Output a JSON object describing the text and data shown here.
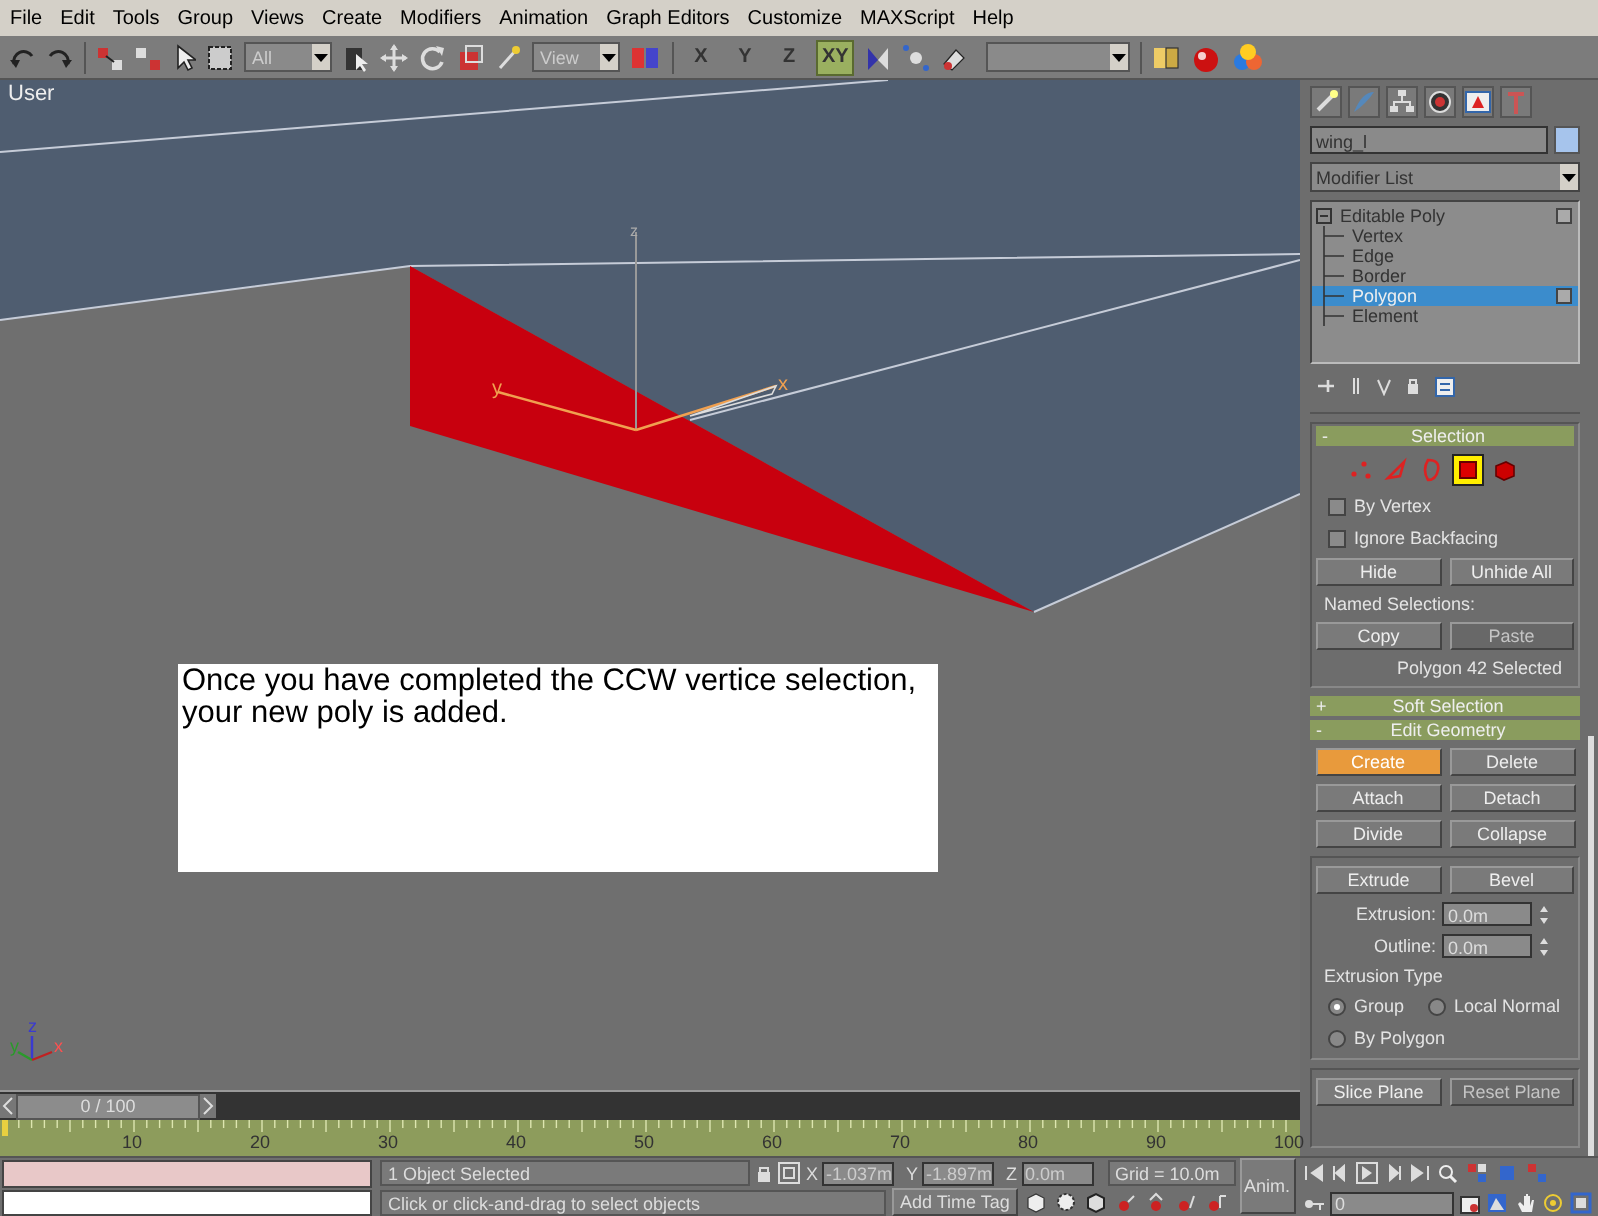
{
  "menu": [
    "File",
    "Edit",
    "Tools",
    "Group",
    "Views",
    "Create",
    "Modifiers",
    "Animation",
    "Graph Editors",
    "Customize",
    "MAXScript",
    "Help"
  ],
  "toolbar": {
    "selection_filter": "All",
    "coordinate_system": "View",
    "axis_buttons": [
      {
        "label": "X",
        "selected": false
      },
      {
        "label": "Y",
        "selected": false
      },
      {
        "label": "Z",
        "selected": false
      },
      {
        "label": "XY",
        "selected": true
      }
    ]
  },
  "viewport": {
    "label": "User",
    "gizmo": {
      "z": "z",
      "y": "y",
      "x": "x"
    },
    "tripod": {
      "z": "z",
      "y": "y",
      "x": "x"
    },
    "note": "Once you have completed the CCW vertice selection, your new poly is added."
  },
  "command_panel": {
    "object_name": "wing_l",
    "modifier_list": "Modifier List",
    "stack": [
      {
        "label": "Editable Poly",
        "selected": false,
        "expanded": true,
        "children": [
          {
            "label": "Vertex",
            "selected": false
          },
          {
            "label": "Edge",
            "selected": false
          },
          {
            "label": "Border",
            "selected": false
          },
          {
            "label": "Polygon",
            "selected": true
          },
          {
            "label": "Element",
            "selected": false
          }
        ]
      }
    ],
    "selection": {
      "toggle": "-",
      "title": "Selection",
      "subobject_levels": [
        {
          "kind": "vertex",
          "selected": false
        },
        {
          "kind": "edge",
          "selected": false
        },
        {
          "kind": "border",
          "selected": false
        },
        {
          "kind": "polygon",
          "selected": true
        },
        {
          "kind": "element",
          "selected": false
        }
      ],
      "checkboxes": [
        {
          "label": "By Vertex",
          "checked": false
        },
        {
          "label": "Ignore Backfacing",
          "checked": false
        }
      ],
      "buttons": [
        {
          "label": "Hide",
          "disabled": false
        },
        {
          "label": "Unhide All",
          "disabled": false
        }
      ],
      "named_selections_label": "Named Selections:",
      "named_buttons": [
        {
          "label": "Copy",
          "disabled": false
        },
        {
          "label": "Paste",
          "disabled": true
        }
      ],
      "status": "Polygon 42 Selected"
    },
    "soft_selection": {
      "toggle": "+",
      "title": "Soft Selection"
    },
    "edit_geometry": {
      "toggle": "-",
      "title": "Edit Geometry",
      "buttons": [
        {
          "label": "Create",
          "active": true,
          "disabled": false
        },
        {
          "label": "Delete",
          "active": false,
          "disabled": false
        },
        {
          "label": "Attach",
          "active": false,
          "disabled": false
        },
        {
          "label": "Detach",
          "active": false,
          "disabled": false
        },
        {
          "label": "Divide",
          "active": false,
          "disabled": false
        },
        {
          "label": "Collapse",
          "active": false,
          "disabled": false
        }
      ],
      "extrude_buttons": [
        {
          "label": "Extrude",
          "disabled": false
        },
        {
          "label": "Bevel",
          "disabled": false
        }
      ],
      "spinners": [
        {
          "label": "Extrusion:",
          "value": "0.0m"
        },
        {
          "label": "Outline:",
          "value": "0.0m"
        }
      ],
      "extrusion_type_label": "Extrusion Type",
      "radios": [
        {
          "label": "Group",
          "selected": true
        },
        {
          "label": "Local Normal",
          "selected": false
        },
        {
          "label": "By Polygon",
          "selected": false
        }
      ],
      "slice_buttons": [
        {
          "label": "Slice Plane",
          "disabled": false
        },
        {
          "label": "Reset Plane",
          "disabled": true
        }
      ]
    }
  },
  "time_slider": {
    "label": "0 / 100"
  },
  "ruler": {
    "ticks": [
      "10",
      "20",
      "30",
      "40",
      "50",
      "60",
      "70",
      "80",
      "90",
      "100"
    ]
  },
  "status_bar": {
    "selection": "1 Object Selected",
    "prompt": "Click or click-and-drag to select objects",
    "coords": [
      {
        "axis": "X",
        "value": "-1.037m"
      },
      {
        "axis": "Y",
        "value": "-1.897m"
      },
      {
        "axis": "Z",
        "value": "0.0m"
      }
    ],
    "grid": "Grid = 10.0m",
    "add_time_tag": "Add Time Tag",
    "anim_button": "Anim.",
    "frame": "0"
  }
}
